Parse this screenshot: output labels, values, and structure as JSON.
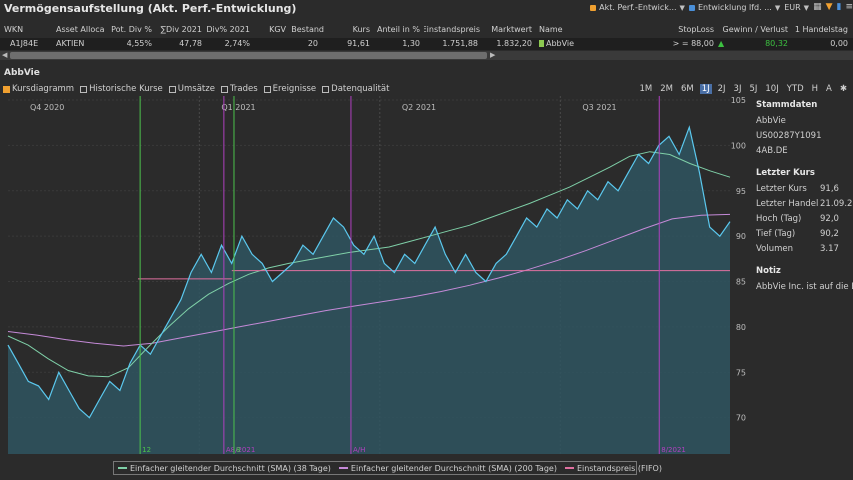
{
  "title": "Vermögensaufstellung (Akt. Perf.-Entwicklung)",
  "toolbar": {
    "dropdown1": "Akt. Perf.-Entwick...",
    "dropdown2": "Entwicklung lfd. ...",
    "currency": "EUR",
    "color_orange": "#f0a030",
    "color_blue": "#4a8fd8"
  },
  "table": {
    "headers": [
      "WKN",
      "Asset Alloca",
      "Pot. Div %",
      "∑Div 2021",
      "Div% 2021",
      "KGV",
      "Bestand",
      "Kurs",
      "Anteil in %",
      "Einstandspreis",
      "Marktwert",
      "Name",
      "StopLoss",
      "Gewinn / Verlust",
      "1 Handelstag"
    ],
    "row": [
      "A1J84E",
      "AKTIEN",
      "4,55%",
      "47,78",
      "2,74%",
      "",
      "20",
      "91,61",
      "1,30",
      "1.751,88",
      "1.832,20",
      "AbbVie",
      "> = 88,00",
      "80,32",
      "0,00"
    ],
    "gain_color": "#3cc040"
  },
  "section_title": "AbbVie",
  "tabs": [
    "Kursdiagramm",
    "Historische Kurse",
    "Umsätze",
    "Trades",
    "Ereignisse",
    "Datenqualität"
  ],
  "ranges": [
    "1M",
    "2M",
    "6M",
    "1J",
    "2J",
    "3J",
    "5J",
    "10J",
    "YTD",
    "H",
    "A"
  ],
  "active_range": "1J",
  "sidebar": {
    "stammdaten_title": "Stammdaten",
    "name": "AbbVie",
    "isin": "US00287Y1091",
    "symbol": "4AB.DE",
    "letzter_kurs_title": "Letzter Kurs",
    "kurs_label": "Letzter Kurs",
    "kurs_value": "91,6",
    "handel_label": "Letzter Handel",
    "handel_value": "21.09.202",
    "hoch_label": "Hoch (Tag)",
    "hoch_value": "92,0",
    "tief_label": "Tief (Tag)",
    "tief_value": "90,2",
    "volumen_label": "Volumen",
    "volumen_value": "3.17",
    "notiz_title": "Notiz",
    "notiz_text": "AbbVie Inc. ist auf die Er"
  },
  "legend": [
    {
      "label": "Einfacher gleitender Durchschnitt (SMA) (38 Tage)",
      "color": "#7fd0a8"
    },
    {
      "label": "Einfacher gleitender Durchschnitt (SMA) (200 Tage)",
      "color": "#c58ad8"
    },
    {
      "label": "Einstandspreis (FIFO)",
      "color": "#e070a0"
    }
  ],
  "chart_data": {
    "type": "area",
    "quarters": [
      "Q4 2020",
      "Q1 2021",
      "Q2 2021",
      "Q3 2021"
    ],
    "y_ticks": [
      70,
      75,
      80,
      85,
      90,
      95,
      100,
      "105"
    ],
    "ylim": [
      66,
      105
    ],
    "price_color": "#5bc8ee",
    "price": [
      78,
      76,
      74,
      73.5,
      72,
      75,
      73,
      71,
      70,
      72,
      74,
      73,
      76,
      78,
      77,
      79,
      81,
      83,
      86,
      88,
      86,
      89,
      87,
      90,
      88,
      87,
      85,
      86,
      87,
      89,
      88,
      90,
      92,
      91,
      89,
      88,
      90,
      87,
      86,
      88,
      87,
      89,
      91,
      88,
      86,
      88,
      86,
      85,
      87,
      88,
      90,
      92,
      91,
      93,
      92,
      94,
      93,
      95,
      94,
      96,
      95,
      97,
      99,
      98,
      100,
      101,
      99,
      102,
      97,
      91,
      90,
      91.6
    ],
    "sma38": [
      79,
      78,
      76.5,
      75.2,
      74.6,
      74.5,
      75.5,
      77.8,
      80,
      82,
      83.6,
      84.8,
      85.8,
      86.5,
      87,
      87.4,
      87.8,
      88.2,
      88.5,
      88.8,
      89.4,
      90,
      90.6,
      91.2,
      92,
      92.8,
      93.6,
      94.5,
      95.4,
      96.5,
      97.6,
      98.8,
      99.3,
      99,
      98,
      97.2,
      96.5
    ],
    "sma200": [
      79.5,
      79.1,
      78.6,
      78.2,
      77.9,
      78.2,
      78.8,
      79.4,
      80,
      80.6,
      81.2,
      81.8,
      82.3,
      82.8,
      83.3,
      83.9,
      84.6,
      85.4,
      86.3,
      87.3,
      88.4,
      89.6,
      90.8,
      91.9,
      92.3,
      92.4
    ],
    "fifo": [
      {
        "from": 0.18,
        "to": 0.31,
        "value": 85.3
      },
      {
        "from": 0.31,
        "to": 1.0,
        "value": 86.2
      }
    ],
    "events": [
      {
        "pos": 0.183,
        "color": "#4cc44c",
        "label": "12"
      },
      {
        "pos": 0.299,
        "color": "#b040c0",
        "label": "A8/2021"
      },
      {
        "pos": 0.313,
        "color": "#4cc44c",
        "label": "8"
      },
      {
        "pos": 0.475,
        "color": "#b040c0",
        "label": "A/H"
      },
      {
        "pos": 0.902,
        "color": "#b040c0",
        "label": "8/2021"
      }
    ]
  }
}
